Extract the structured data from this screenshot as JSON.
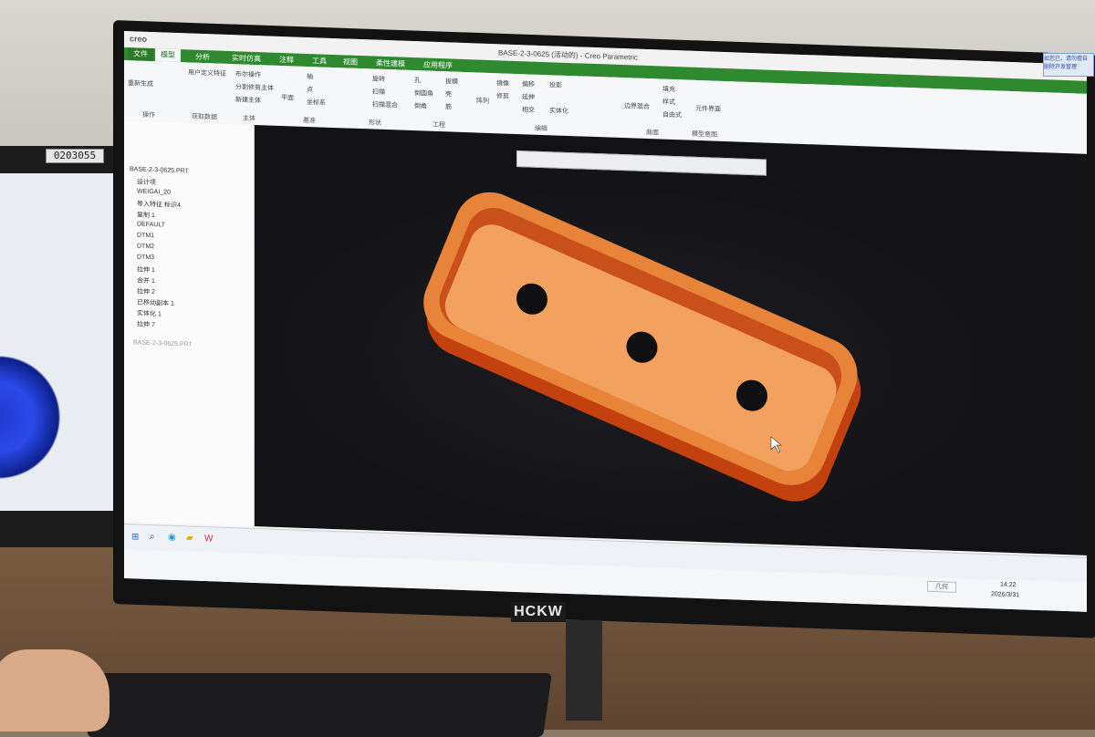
{
  "left_monitor": {
    "label": "0203055"
  },
  "window": {
    "app_logo": "creo",
    "title": "BASE-2-3-0625 (活动的) - Creo Parametric"
  },
  "tabs": [
    "文件",
    "模型",
    "分析",
    "实时仿真",
    "注释",
    "工具",
    "视图",
    "柔性建模",
    "应用程序"
  ],
  "ribbon": {
    "buttons": [
      "重新生成",
      "用户定义特征",
      "布尔操作",
      "分割修剪主体",
      "新建主体",
      "平面",
      "轴",
      "点",
      "坐标系",
      "旋转",
      "扫描",
      "扫描混合",
      "孔",
      "倒圆角",
      "倒角",
      "拔模",
      "壳",
      "筋",
      "阵列",
      "镜像",
      "修剪",
      "偏移",
      "投影",
      "延伸",
      "相交",
      "实体化",
      "边界混合",
      "填充",
      "样式",
      "自由式",
      "元件界面"
    ],
    "groups": [
      "操作",
      "获取数据",
      "主体",
      "基准",
      "形状",
      "工程",
      "编辑",
      "曲面",
      "模型意图"
    ]
  },
  "model_tree": {
    "root": "BASE-2-3-0625.PRT",
    "items": [
      "设计项",
      "WEIGAI_20",
      "导入特征 标识4",
      "复制 1",
      "DEFAULT",
      "DTM1",
      "DTM2",
      "DTM3",
      "拉伸 1",
      "合并 1",
      "拉伸 2",
      "已移动副本 1",
      "实体化 1",
      "拉伸 7"
    ],
    "layer_root": "BASE-2-3-0625.PRT"
  },
  "statusbar": {
    "filter": "几何",
    "time": "14:22",
    "date": "2026/3/31"
  },
  "monitor": {
    "brand": "HCKW"
  },
  "sticker": {
    "line1": "如您已，请勿擅自",
    "line2": "删除开发管理"
  }
}
